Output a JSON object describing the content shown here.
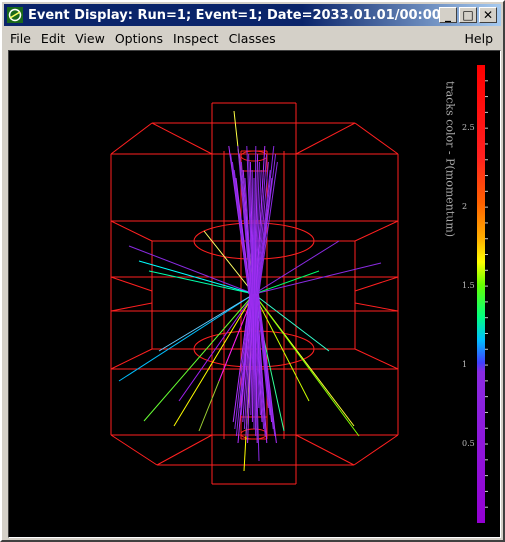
{
  "window": {
    "title": "Event Display: Run=1; Event=1; Date=2033.01.01/00:00...",
    "buttons": {
      "minimize": "_",
      "maximize": "□",
      "close": "✕"
    }
  },
  "menu": {
    "items": [
      "File",
      "Edit",
      "View",
      "Options",
      "Inspect",
      "Classes"
    ],
    "help": "Help"
  },
  "colorscale": {
    "title": "tracks color - P(momentum)",
    "labels": [
      "2.5",
      "2",
      "1.5",
      "1",
      "0.5"
    ],
    "label_values": [
      2.5,
      2,
      1.5,
      1,
      0.5
    ],
    "min": 0.0,
    "max": 2.9
  },
  "colors": {
    "detector": "#ff2020",
    "background": "#000000",
    "title_bar": "#0a246a"
  }
}
